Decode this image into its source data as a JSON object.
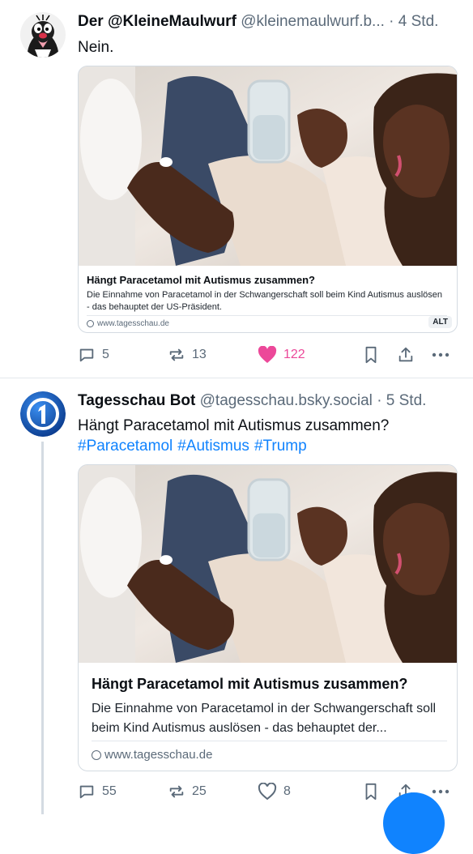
{
  "posts": [
    {
      "display_name": "Der @KleineMaulwurf",
      "handle": "@kleinemaulwurf.b...",
      "time": "· 4 Std.",
      "text": "Nein.",
      "card": {
        "title": "Hängt Paracetamol mit Autismus zusammen?",
        "description": "Die Einnahme von Paracetamol in der Schwangerschaft soll beim Kind Autismus auslösen - das behauptet der US-Präsident.",
        "domain": "www.tagesschau.de",
        "alt_badge": "ALT"
      },
      "actions": {
        "replies": "5",
        "reposts": "13",
        "likes": "122"
      }
    },
    {
      "display_name": "Tagesschau Bot",
      "handle": "@tagesschau.bsky.social",
      "time": "· 5 Std.",
      "text": "Hängt Paracetamol mit Autismus zusammen?",
      "tags": [
        "#Paracetamol",
        "#Autismus",
        "#Trump"
      ],
      "card": {
        "title": "Hängt Paracetamol mit Autismus zusammen?",
        "description": "Die Einnahme von Paracetamol in der Schwangerschaft soll beim Kind Autismus auslösen - das behauptet der...",
        "domain": "www.tagesschau.de"
      },
      "actions": {
        "replies": "55",
        "reposts": "25",
        "likes": "8"
      }
    }
  ],
  "icons": [
    "reply-icon",
    "repost-icon",
    "like-icon",
    "bookmark-icon",
    "share-icon",
    "more-icon",
    "globe-icon"
  ],
  "colors": {
    "accent": "#1083fe",
    "like": "#ec4899",
    "muted": "#5b6a79",
    "border": "#d4dbe2"
  }
}
